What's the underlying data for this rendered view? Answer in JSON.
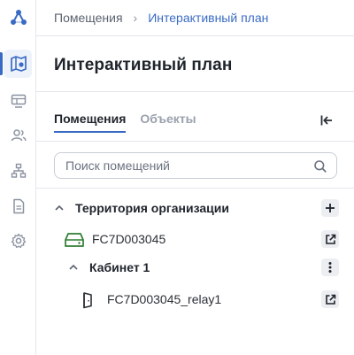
{
  "breadcrumb": {
    "root": "Помещения",
    "separator": "›",
    "current": "Интерактивный план"
  },
  "page": {
    "title": "Интерактивный план"
  },
  "tabs": [
    {
      "label": "Помещения",
      "active": true
    },
    {
      "label": "Объекты",
      "active": false
    }
  ],
  "search": {
    "placeholder": "Поиск помещений",
    "value": ""
  },
  "tree": {
    "root": {
      "label": "Территория организации",
      "expanded": true,
      "action_icon": "plus-icon"
    },
    "device1": {
      "label": "FC7D003045",
      "icon": "router-icon",
      "action_icon": "open-external-icon"
    },
    "room": {
      "label": "Кабинет 1",
      "expanded": true,
      "action_icon": "more-vertical-icon"
    },
    "device2": {
      "label": "FC7D003045_relay1",
      "icon": "door-icon",
      "action_icon": "open-external-icon"
    }
  },
  "sidebar": {
    "items": [
      {
        "icon": "app-logo-icon"
      },
      {
        "icon": "map-icon",
        "active": true
      },
      {
        "icon": "cameras-icon"
      },
      {
        "icon": "users-icon"
      },
      {
        "icon": "structure-icon"
      },
      {
        "icon": "document-icon"
      },
      {
        "icon": "settings-icon"
      }
    ]
  },
  "colors": {
    "accent": "#3a6bc4",
    "device_green": "#2e7d32",
    "text": "#1f242c",
    "muted": "#9aa1ac"
  }
}
